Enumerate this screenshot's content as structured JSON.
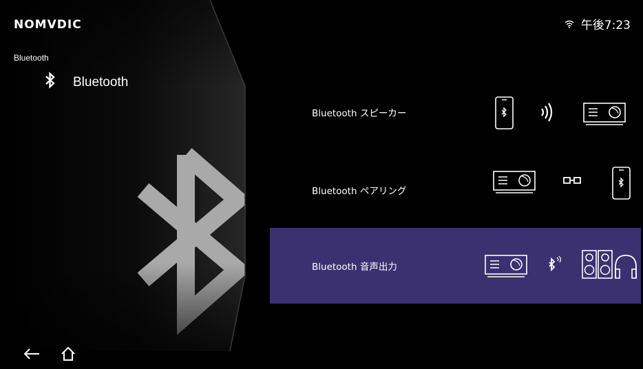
{
  "brand": {
    "logo_text": "NOMVDIC"
  },
  "status_bar": {
    "clock": "午後7:23",
    "wifi_icon": "wifi-icon"
  },
  "breadcrumb": "Bluetooth",
  "section": {
    "title": "Bluetooth",
    "icon": "bluetooth-icon"
  },
  "menu": {
    "items": [
      {
        "label": "Bluetooth スピーカー",
        "selected": false,
        "diagram": "phone-to-projector"
      },
      {
        "label": "Bluetooth ペアリング",
        "selected": false,
        "diagram": "projector-link-phone"
      },
      {
        "label": "Bluetooth 音声出力",
        "selected": true,
        "diagram": "projector-to-speakers-headphones"
      }
    ]
  },
  "nav": {
    "back_icon": "back-arrow-icon",
    "home_icon": "home-icon"
  },
  "colors": {
    "background": "#000000",
    "selected_item": "#3c3170",
    "watermark": "#a9a9a9",
    "text": "#ffffff"
  }
}
